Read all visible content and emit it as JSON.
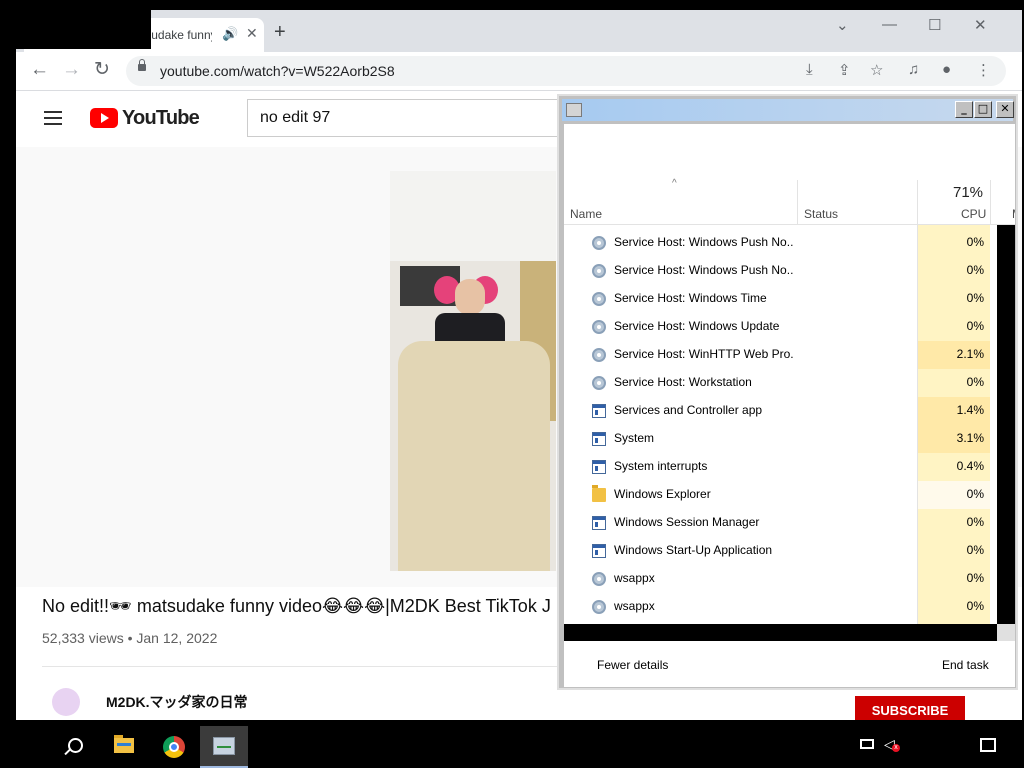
{
  "browser": {
    "tab": {
      "title": "No edit!!🕶 matsudake funny video",
      "speaker_icon": "speaker-icon",
      "close_glyph": "✕"
    },
    "newtab_glyph": "+",
    "window_controls": {
      "dropdown": "⌄",
      "minimize": "—",
      "maximize": "☐",
      "close": "✕"
    },
    "nav": {
      "back": "←",
      "forward": "→",
      "reload": "↻"
    },
    "url": "youtube.com/watch?v=W522Aorb2S8",
    "toolbar_icons": [
      "install-icon",
      "share-icon",
      "star-icon",
      "media-icon",
      "profile-icon",
      "menu-icon"
    ]
  },
  "youtube": {
    "logo_text": "YouTube",
    "search_query": "no edit 97",
    "video_title": "No edit!!🕶 matsudake funny video😂😂😂|M2DK Best TikTok J",
    "video_meta": "52,333 views • Jan 12, 2022",
    "channel_name": "M2DK.マッダ家の日常",
    "subscribe_label": "SUBSCRIBE"
  },
  "task_manager": {
    "columns": {
      "name": "Name",
      "status": "Status",
      "cpu_total": "71%",
      "cpu": "CPU",
      "next_cut": "M"
    },
    "processes": [
      {
        "name": "Service Host: Windows Push No...",
        "cpu": "0%",
        "icon": "gear-icon"
      },
      {
        "name": "Service Host: Windows Push No...",
        "cpu": "0%",
        "icon": "gear-icon"
      },
      {
        "name": "Service Host: Windows Time",
        "cpu": "0%",
        "icon": "gear-icon"
      },
      {
        "name": "Service Host: Windows Update",
        "cpu": "0%",
        "icon": "gear-icon"
      },
      {
        "name": "Service Host: WinHTTP Web Pro...",
        "cpu": "2.1%",
        "icon": "gear-icon"
      },
      {
        "name": "Service Host: Workstation",
        "cpu": "0%",
        "icon": "gear-icon"
      },
      {
        "name": "Services and Controller app",
        "cpu": "1.4%",
        "icon": "window-icon"
      },
      {
        "name": "System",
        "cpu": "3.1%",
        "icon": "window-icon"
      },
      {
        "name": "System interrupts",
        "cpu": "0.4%",
        "icon": "window-icon"
      },
      {
        "name": "Windows Explorer",
        "cpu": "0%",
        "icon": "folder-icon"
      },
      {
        "name": "Windows Session Manager",
        "cpu": "0%",
        "icon": "window-icon"
      },
      {
        "name": "Windows Start-Up Application",
        "cpu": "0%",
        "icon": "window-icon"
      },
      {
        "name": "wsappx",
        "cpu": "0%",
        "icon": "gear-icon"
      },
      {
        "name": "wsappx",
        "cpu": "0%",
        "icon": "gear-icon"
      }
    ],
    "fewer_details": "Fewer details",
    "end_task": "End task",
    "colors": {
      "cpu_low": "#fff4c4",
      "cpu_mid": "#ffe9a8",
      "cpu_none": "#fffaeb"
    }
  },
  "taskbar": {
    "items": [
      "search-icon",
      "file-explorer-icon",
      "chrome-icon",
      "task-manager-icon"
    ],
    "tray": [
      "network-icon",
      "volume-muted-icon",
      "notifications-icon"
    ]
  }
}
